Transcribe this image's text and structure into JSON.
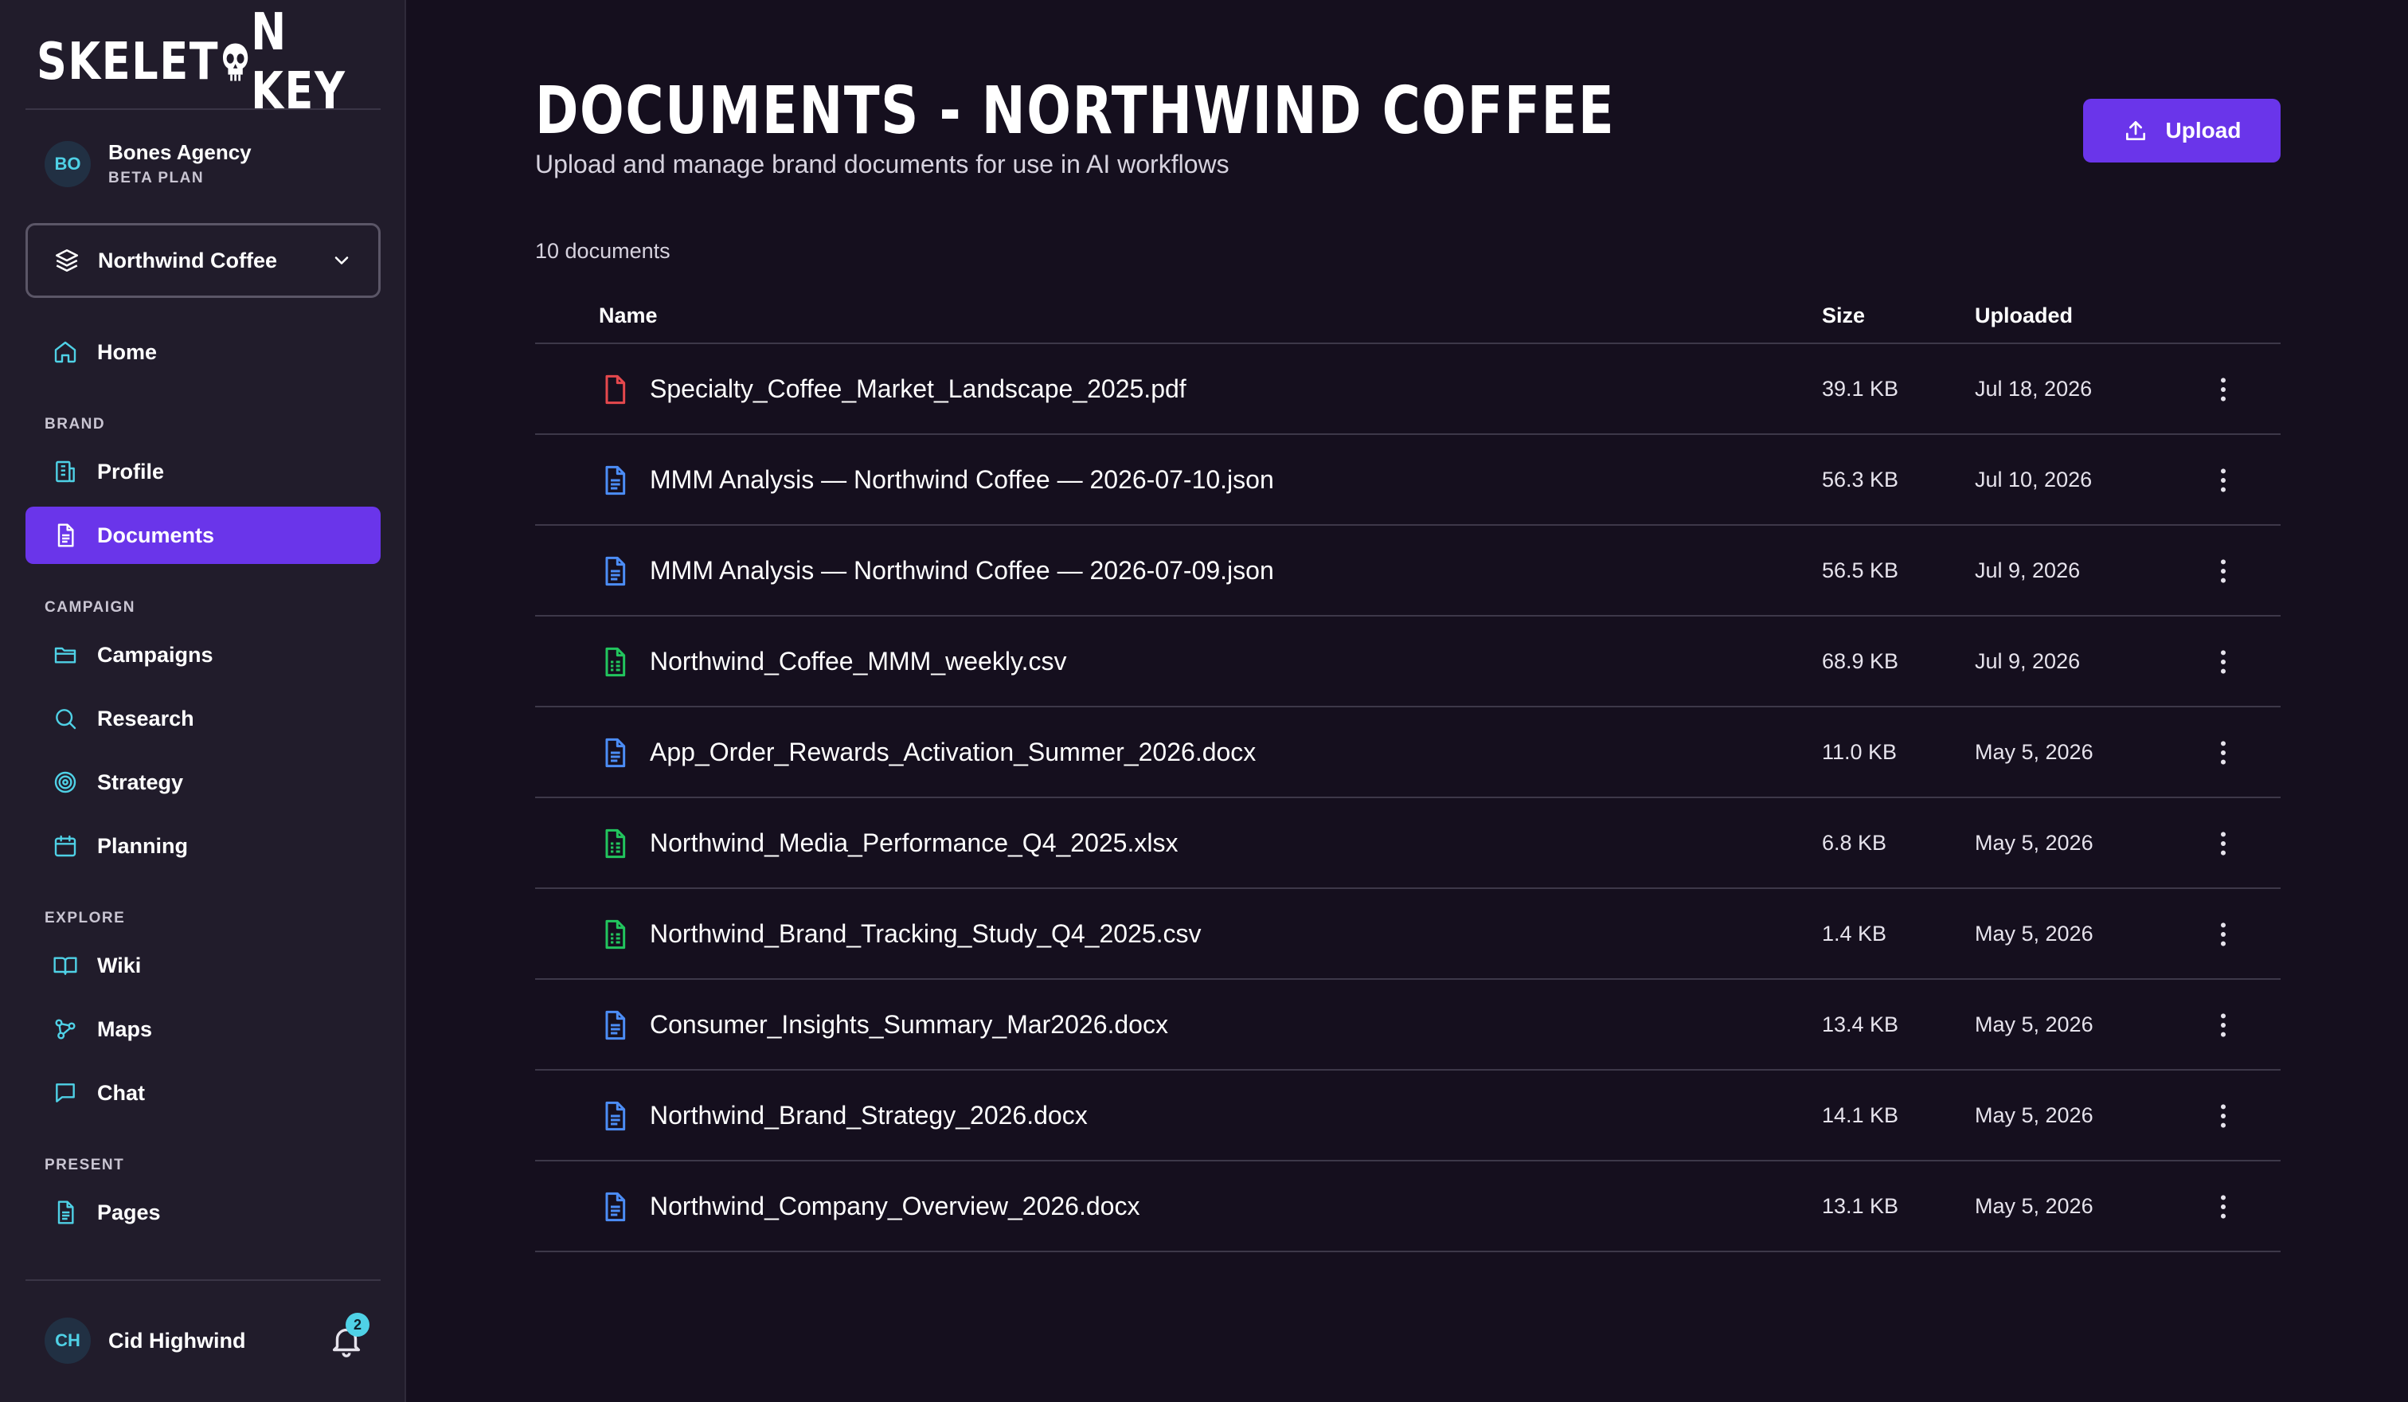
{
  "app": {
    "logo_left": "SKELET",
    "logo_right": "N KEY"
  },
  "sidebar": {
    "agency": {
      "initials": "BO",
      "name": "Bones Agency",
      "plan": "BETA PLAN"
    },
    "brand_selector": {
      "value": "Northwind Coffee"
    },
    "home": {
      "label": "Home",
      "icon": "home-icon"
    },
    "sections": {
      "brand": "BRAND",
      "campaign": "CAMPAIGN",
      "explore": "EXPLORE",
      "present": "PRESENT"
    },
    "items": {
      "profile": "Profile",
      "documents": "Documents",
      "campaigns": "Campaigns",
      "research": "Research",
      "strategy": "Strategy",
      "planning": "Planning",
      "wiki": "Wiki",
      "maps": "Maps",
      "chat": "Chat",
      "pages": "Pages"
    },
    "active_item": "documents",
    "user": {
      "initials": "CH",
      "name": "Cid Highwind",
      "notifications": "2"
    }
  },
  "main": {
    "title": "DOCUMENTS - NORTHWIND COFFEE",
    "subtitle": "Upload and manage brand documents for use in AI workflows",
    "upload_label": "Upload",
    "doc_count": "10 documents",
    "columns": {
      "name": "Name",
      "size": "Size",
      "uploaded": "Uploaded"
    },
    "documents": [
      {
        "name": "Specialty_Coffee_Market_Landscape_2025.pdf",
        "size": "39.1 KB",
        "uploaded": "Jul 18, 2026",
        "type": "pdf"
      },
      {
        "name": "MMM Analysis — Northwind Coffee — 2026-07-10.json",
        "size": "56.3 KB",
        "uploaded": "Jul 10, 2026",
        "type": "doc"
      },
      {
        "name": "MMM Analysis — Northwind Coffee — 2026-07-09.json",
        "size": "56.5 KB",
        "uploaded": "Jul 9, 2026",
        "type": "doc"
      },
      {
        "name": "Northwind_Coffee_MMM_weekly.csv",
        "size": "68.9 KB",
        "uploaded": "Jul 9, 2026",
        "type": "sheet"
      },
      {
        "name": "App_Order_Rewards_Activation_Summer_2026.docx",
        "size": "11.0 KB",
        "uploaded": "May 5, 2026",
        "type": "doc"
      },
      {
        "name": "Northwind_Media_Performance_Q4_2025.xlsx",
        "size": "6.8 KB",
        "uploaded": "May 5, 2026",
        "type": "sheet"
      },
      {
        "name": "Northwind_Brand_Tracking_Study_Q4_2025.csv",
        "size": "1.4 KB",
        "uploaded": "May 5, 2026",
        "type": "sheet"
      },
      {
        "name": "Consumer_Insights_Summary_Mar2026.docx",
        "size": "13.4 KB",
        "uploaded": "May 5, 2026",
        "type": "doc"
      },
      {
        "name": "Northwind_Brand_Strategy_2026.docx",
        "size": "14.1 KB",
        "uploaded": "May 5, 2026",
        "type": "doc"
      },
      {
        "name": "Northwind_Company_Overview_2026.docx",
        "size": "13.1 KB",
        "uploaded": "May 5, 2026",
        "type": "doc"
      }
    ]
  },
  "colors": {
    "accent": "#6a35ea",
    "teal": "#4fd1e6",
    "pdf_icon": "#e5484d",
    "doc_icon": "#4c8df6",
    "sheet_icon": "#22c55e"
  }
}
